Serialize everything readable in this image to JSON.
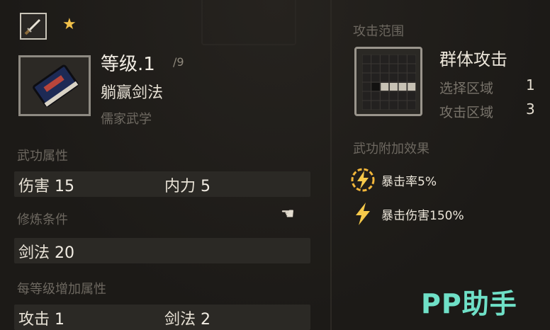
{
  "header": {
    "level_label": "等级.1",
    "level_max": "/9",
    "skill_name": "躺赢剑法",
    "school": "儒家武学"
  },
  "stats_section": {
    "title": "武功属性",
    "damage_label": "伤害",
    "damage_value": "15",
    "inner_label": "内力",
    "inner_value": "5"
  },
  "training_section": {
    "title": "修炼条件",
    "skill_label": "剑法",
    "skill_value": "20"
  },
  "per_level_section": {
    "title": "每等级增加属性",
    "attack_label": "攻击",
    "attack_value": "1",
    "sword_label": "剑法",
    "sword_value": "2"
  },
  "range_section": {
    "title": "攻击范围",
    "type": "群体攻击",
    "select_label": "选择区域",
    "select_value": "1",
    "attack_area_label": "攻击区域",
    "attack_area_value": "3"
  },
  "effects_section": {
    "title": "武功附加效果",
    "effects": [
      {
        "icon": "lightning-ring-icon",
        "label": "暴击率5%"
      },
      {
        "icon": "lightning-icon",
        "label": "暴击伤害150%"
      }
    ]
  },
  "watermark": "PP助手",
  "colors": {
    "accent_gold": "#f2c14a",
    "watermark": "#6fe0c7",
    "background": "#1e1c19"
  }
}
